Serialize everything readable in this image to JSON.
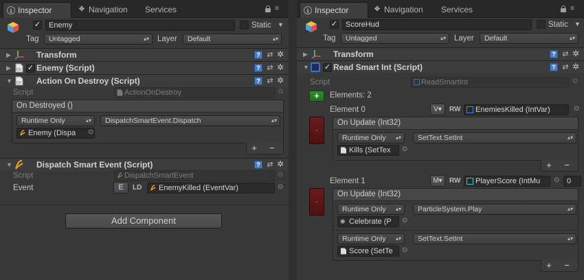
{
  "colors": {
    "accent_blue": "#4a7bc0",
    "remove_red": "#5e1616",
    "add_green": "#2a7f2a",
    "event_orange": "#e39a2a"
  },
  "left": {
    "tabs": {
      "inspector": "Inspector",
      "navigation": "Navigation",
      "services": "Services"
    },
    "gameobject": {
      "active": true,
      "name": "Enemy",
      "static_label": "Static",
      "tag_label": "Tag",
      "tag_value": "Untagged",
      "layer_label": "Layer",
      "layer_value": "Default"
    },
    "components": {
      "transform": {
        "title": "Transform"
      },
      "enemy_script": {
        "title": "Enemy (Script)",
        "enabled": true
      },
      "action_on_destroy": {
        "title": "Action On Destroy (Script)",
        "script_label": "Script",
        "script_value": "ActionOnDestroy",
        "event_title": "On Destroyed ()",
        "runtime": "Runtime Only",
        "method": "DispatchSmartEvent.Dispatch",
        "target": "Enemy (Dispa",
        "plus": "+",
        "minus": "−"
      },
      "dispatch_smart_event": {
        "title": "Dispatch Smart Event (Script)",
        "script_label": "Script",
        "script_value": "DispatchSmartEvent",
        "event_label": "Event",
        "e_button": "E",
        "ld_label": "LD",
        "event_value": "EnemyKilled (EventVar)"
      }
    },
    "add_component": "Add Component"
  },
  "right": {
    "tabs": {
      "inspector": "Inspector",
      "navigation": "Navigation",
      "services": "Services"
    },
    "gameobject": {
      "active": true,
      "name": "ScoreHud",
      "static_label": "Static",
      "tag_label": "Tag",
      "tag_value": "Untagged",
      "layer_label": "Layer",
      "layer_value": "Default"
    },
    "components": {
      "transform": {
        "title": "Transform"
      },
      "read_smart_int": {
        "title": "Read Smart Int (Script)",
        "enabled": true,
        "script_label": "Script",
        "script_value": "ReadSmartInt",
        "elements_label": "Elements: 2",
        "add_symbol": "+",
        "elements": [
          {
            "label": "Element 0",
            "type_button": "V",
            "rw": "RW",
            "var_value": "EnemiesKilled (IntVar)",
            "extra_value": "",
            "event_title": "On Update (Int32)",
            "calls": [
              {
                "runtime": "Runtime Only",
                "method": "SetText.SetInt",
                "target": "Kills (SetTex"
              }
            ]
          },
          {
            "label": "Element 1",
            "type_button": "M",
            "rw": "RW",
            "var_value": "PlayerScore (IntMu",
            "extra_value": "0",
            "event_title": "On Update (Int32)",
            "calls": [
              {
                "runtime": "Runtime Only",
                "method": "ParticleSystem.Play",
                "target": "Celebrate (P"
              },
              {
                "runtime": "Runtime Only",
                "method": "SetText.SetInt",
                "target": "Score (SetTe"
              }
            ]
          }
        ],
        "remove_symbol": "-",
        "plus": "+",
        "minus": "−"
      }
    }
  }
}
